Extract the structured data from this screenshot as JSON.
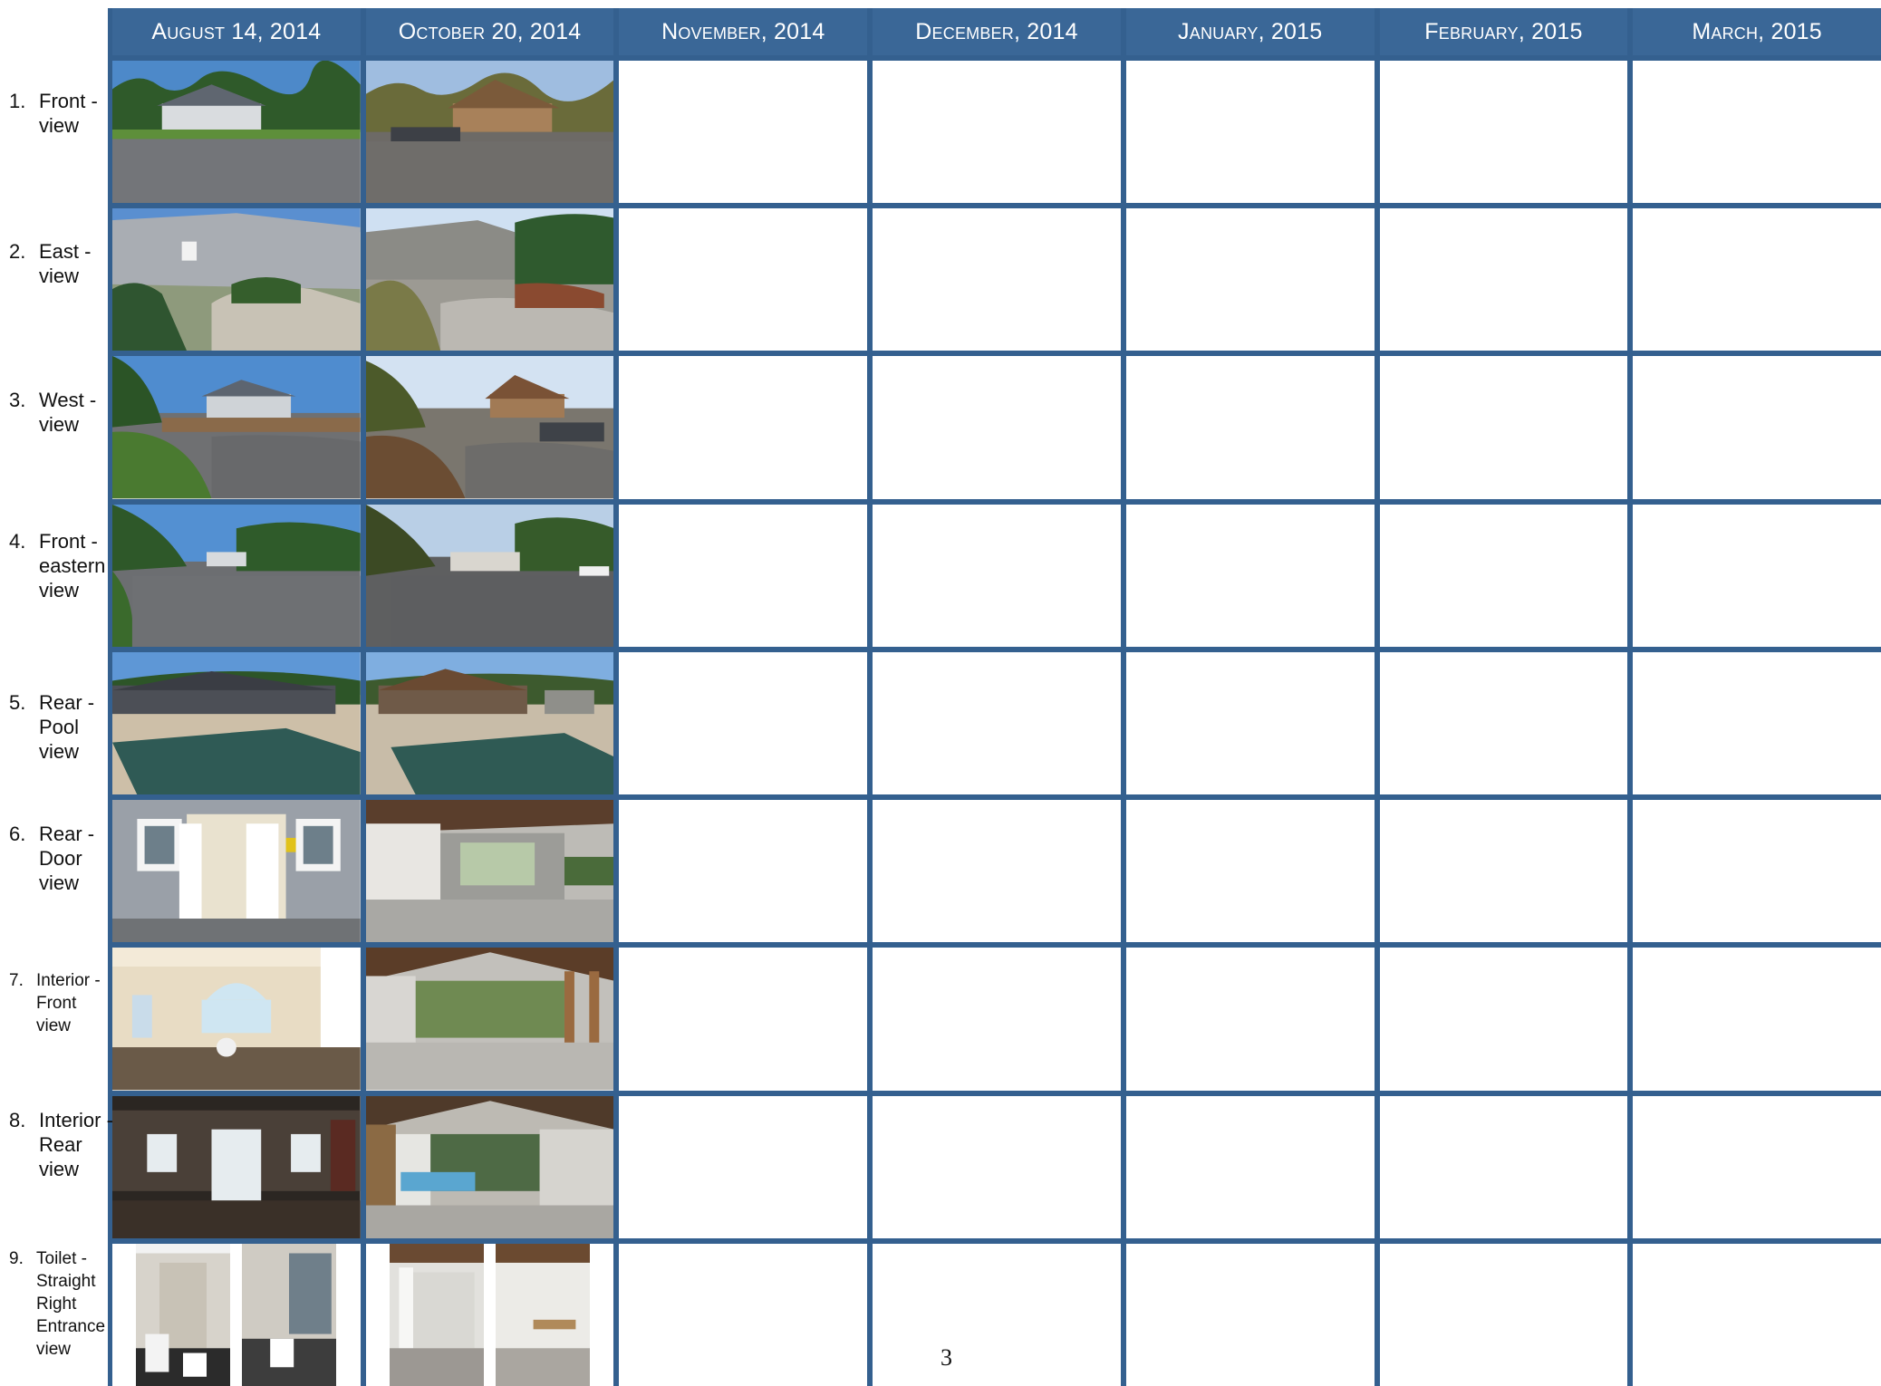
{
  "columns": [
    "August 14, 2014",
    "October 20, 2014",
    "November, 2014",
    "December, 2014",
    "January, 2015",
    "February, 2015",
    "March, 2015"
  ],
  "rows": [
    {
      "num": "1.",
      "lines": [
        "Front -",
        "view"
      ]
    },
    {
      "num": "2.",
      "lines": [
        "East -",
        "view"
      ]
    },
    {
      "num": "3.",
      "lines": [
        "West -",
        "view"
      ]
    },
    {
      "num": "4.",
      "lines": [
        "Front -",
        "eastern",
        "view"
      ]
    },
    {
      "num": "5.",
      "lines": [
        "Rear -",
        "Pool",
        "view"
      ]
    },
    {
      "num": "6.",
      "lines": [
        "Rear -",
        "Door",
        "view"
      ]
    },
    {
      "num": "7.",
      "lines": [
        "Interior -",
        "Front",
        "view"
      ]
    },
    {
      "num": "8.",
      "lines": [
        "Interior -",
        "Rear",
        "view"
      ]
    },
    {
      "num": "9.",
      "lines": [
        "Toilet -",
        "Straight",
        "Right",
        "Entrance",
        "view"
      ]
    }
  ],
  "page_number": "3",
  "colors": {
    "grid_blue": "#34608f",
    "header_blue": "#3a6797",
    "header_text": "#ffffff"
  }
}
